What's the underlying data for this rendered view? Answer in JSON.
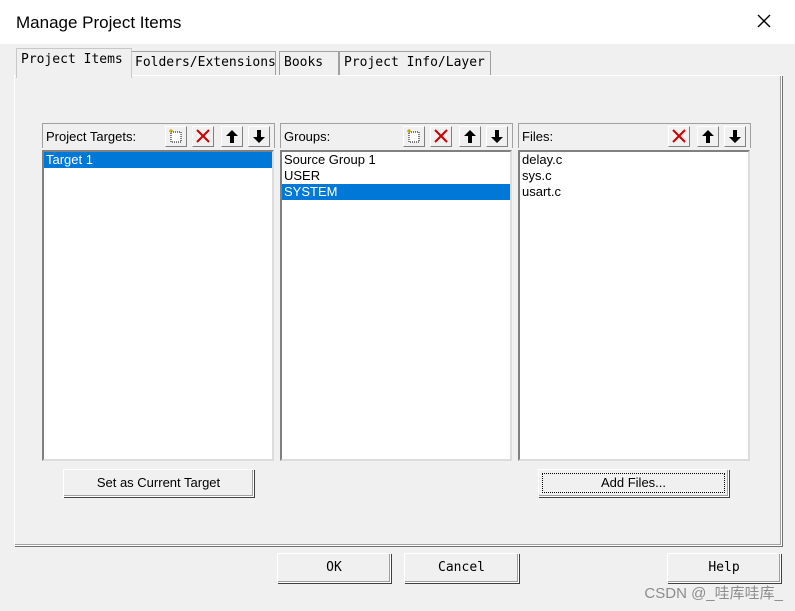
{
  "window": {
    "title": "Manage Project Items"
  },
  "tabs": [
    "Project Items",
    "Folders/Extensions",
    "Books",
    "Project Info/Layer"
  ],
  "targets": {
    "label": "Project Targets:",
    "items": [
      "Target 1"
    ],
    "selected": 0
  },
  "groups": {
    "label": "Groups:",
    "items": [
      "Source Group 1",
      "USER",
      "SYSTEM"
    ],
    "selected": 2
  },
  "files": {
    "label": "Files:",
    "items": [
      "delay.c",
      "sys.c",
      "usart.c"
    ]
  },
  "buttons": {
    "set_current": "Set as Current Target",
    "add_files": "Add Files...",
    "ok": "OK",
    "cancel": "Cancel",
    "help": "Help"
  },
  "watermark": "CSDN @_哇库哇库_",
  "colors": {
    "selection": "#0078d7",
    "delete_icon": "#cc0000"
  }
}
